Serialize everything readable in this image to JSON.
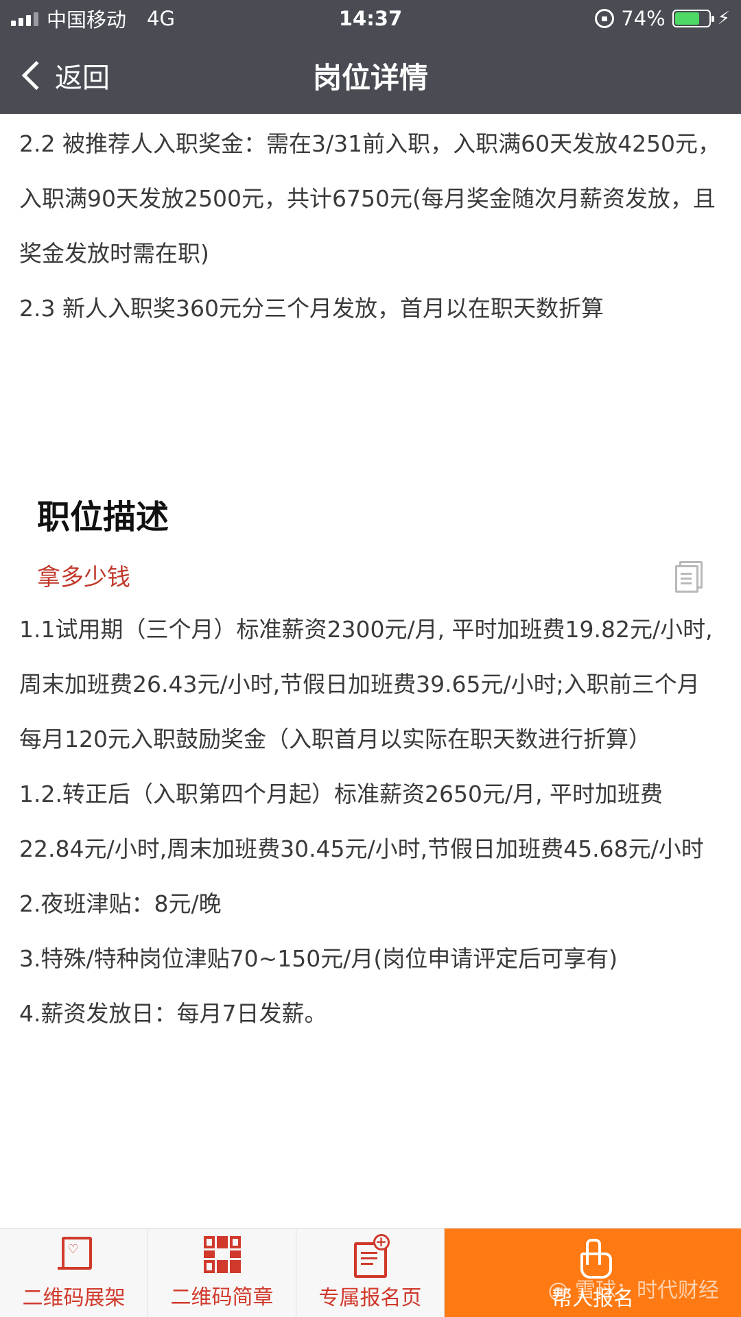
{
  "status_bar": {
    "carrier": "中国移动",
    "network": "4G",
    "time": "14:37",
    "battery": "74%",
    "battery_level": 0.74
  },
  "nav": {
    "back_label": "返回",
    "title": "岗位详情"
  },
  "top_paragraphs": [
    "2.2 被推荐人入职奖金：需在3/31前入职，入职满60天发放4250元，入职满90天发放2500元，共计6750元(每月奖金随次月薪资发放，且奖金发放时需在职)",
    "2.3 新人入职奖360元分三个月发放，首月以在职天数折算"
  ],
  "section": {
    "title": "职位描述",
    "subhead": "拿多少钱",
    "paragraphs": [
      "1.1试用期（三个月）标准薪资2300元/月, 平时加班费19.82元/小时,周末加班费26.43元/小时,节假日加班费39.65元/小时;入职前三个月每月120元入职鼓励奖金（入职首月以实际在职天数进行折算）",
      "1.2.转正后（入职第四个月起）标准薪资2650元/月, 平时加班费22.84元/小时,周末加班费30.45元/小时,节假日加班费45.68元/小时",
      "2.夜班津贴：8元/晚",
      "3.特殊/特种岗位津贴70~150元/月(岗位申请评定后可享有)",
      "4.薪资发放日：每月7日发薪。"
    ]
  },
  "bottom_tabs": {
    "qr_stand": "二维码展架",
    "qr_brochure": "二维码简章",
    "signup_page": "专属报名页",
    "cta": "帮人报名",
    "watermark": "@ 雪球：时代财经"
  },
  "icons": {
    "back": "chevron-left-icon",
    "copy": "document-copy-icon",
    "qr_stand": "easel-icon",
    "qr_brochure": "qr-code-icon",
    "signup_page": "form-add-icon",
    "cta": "tap-hand-icon"
  },
  "colors": {
    "nav_bg": "#4a4c54",
    "accent_red": "#d0392b",
    "cta_orange": "#ff7a12",
    "battery_green": "#4cd964"
  }
}
